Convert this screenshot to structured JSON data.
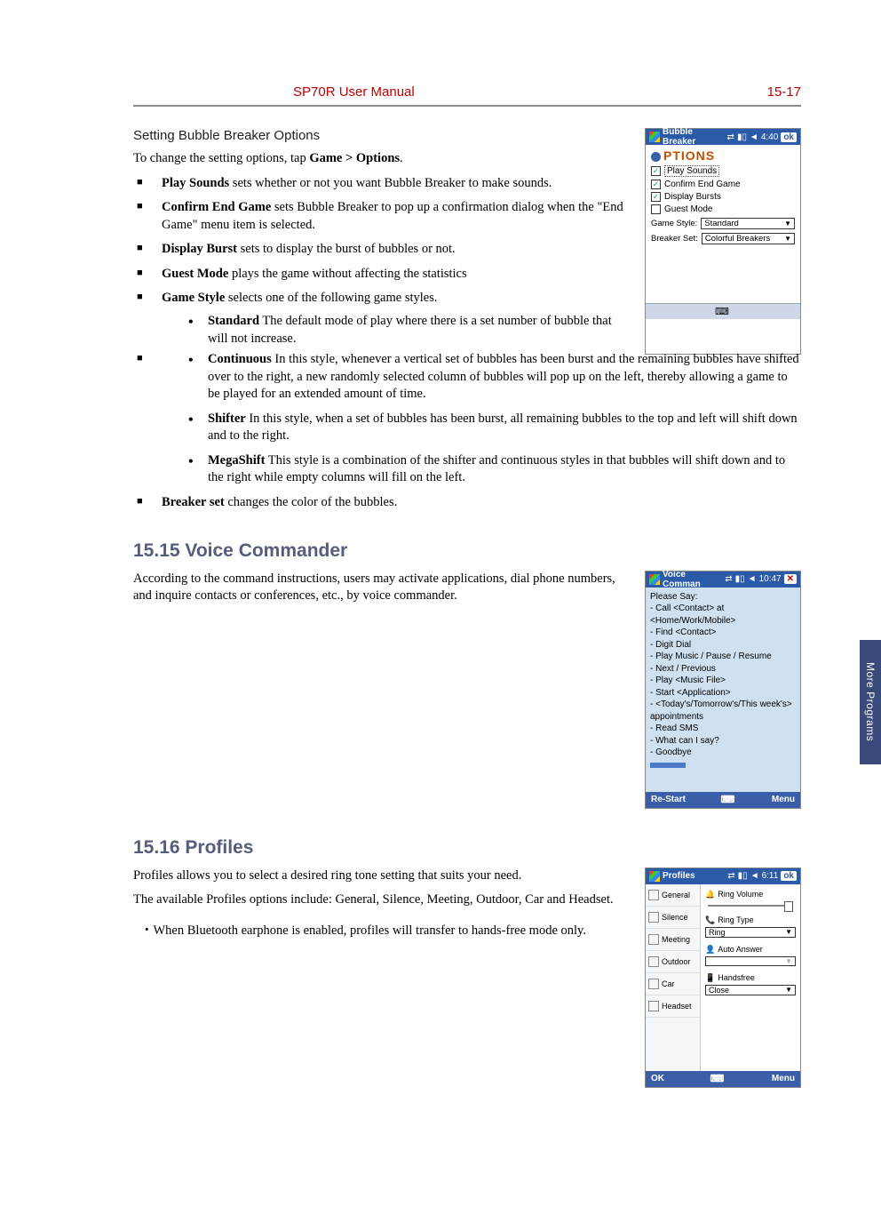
{
  "header": {
    "title": "SP70R User Manual",
    "page": "15-17"
  },
  "sideTab": "More Programs",
  "s1": {
    "title": "Setting Bubble Breaker Options",
    "intro_a": "To change the setting options, tap ",
    "intro_b": "Game > Options",
    "intro_c": ".",
    "items": {
      "playSounds_b": "Play Sounds",
      "playSounds_t": "  sets whether or not you want Bubble Breaker to make sounds.",
      "confirm_b": "Confirm End Game",
      "confirm_t": "  sets Bubble Breaker to pop up a confirmation dialog when the \"End Game\" menu item is selected.",
      "display_b": "Display Burst",
      "display_t": "  sets to display the burst of bubbles or not.",
      "guest_b": "Guest Mode",
      "guest_t": "  plays the game without affecting the statistics",
      "style_b": "Game Style",
      "style_t": "  selects one of the following game styles.",
      "std_b": "Standard",
      "std_t": "  The default mode of play where there is a set number of bubble that will not increase.",
      "cont_b": "Continuous",
      "cont_t": "  In this style, whenever a vertical set of bubbles has been burst and the remaining bubbles have shifted over to the right, a new randomly selected column of bubbles will pop up on the left, thereby allowing a game to be played for an extended amount of time.",
      "shift_b": "Shifter",
      "shift_t": "  In this style, when a set of bubbles has been burst, all remaining bubbles to the top and left will shift down and to the right.",
      "mega_b": "MegaShift",
      "mega_t": "  This style is a combination of the shifter and continuous styles in that bubbles will shift down and to the right while empty columns will fill on the left.",
      "breaker_b": "Breaker set",
      "breaker_t": "  changes the color of the bubbles."
    }
  },
  "s2": {
    "heading": "15.15  Voice Commander",
    "para": "According to the command instructions, users may activate applications, dial phone numbers, and inquire contacts or conferences, etc., by voice commander."
  },
  "s3": {
    "heading": "15.16  Profiles",
    "p1": "Profiles allows you to select a desired ring tone setting that suits your need.",
    "p2": "The available Profiles options include: General, Silence, Meeting, Outdoor, Car and Headset.",
    "note": "・When Bluetooth earphone is enabled, profiles will transfer to hands-free mode only."
  },
  "shot1": {
    "title": "Bubble Breaker",
    "time": "4:40",
    "ok": "ok",
    "head": "PTIONS",
    "c1": "Play Sounds",
    "c2": "Confirm End Game",
    "c3": "Display Bursts",
    "c4": "Guest Mode",
    "l1": "Game Style:",
    "v1": "Standard",
    "l2": "Breaker Set:",
    "v2": "Colorful Breakers"
  },
  "shot2": {
    "title": "Voice Comman",
    "time": "10:47",
    "lines": [
      "Please Say:",
      "- Call <Contact> at",
      "   <Home/Work/Mobile>",
      "- Find <Contact>",
      "- Digit Dial",
      "- Play Music / Pause / Resume",
      "- Next / Previous",
      "- Play <Music File>",
      "- Start <Application>",
      "- <Today's/Tomorrow's/This week's>",
      "   appointments",
      "- Read SMS",
      "- What can I say?",
      "- Goodbye"
    ],
    "left": "Re-Start",
    "right": "Menu"
  },
  "shot3": {
    "title": "Profiles",
    "time": "6:11",
    "ok": "ok",
    "left": [
      "General",
      "Silence",
      "Meeting",
      "Outdoor",
      "Car",
      "Headset"
    ],
    "r1": "Ring Volume",
    "r2": "Ring Type",
    "r2v": "Ring",
    "r3": "Auto Answer",
    "r4": "Handsfree",
    "r4v": "Close",
    "bl": "OK",
    "br": "Menu"
  }
}
